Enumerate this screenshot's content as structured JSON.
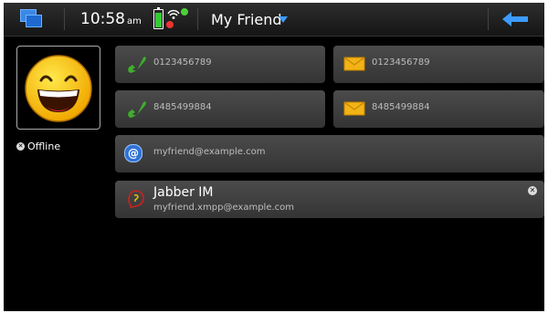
{
  "statusbar": {
    "time": "10:58",
    "ampm": "am",
    "title": "My Friend",
    "icons": [
      "task-switcher-icon",
      "battery-icon",
      "signal-icon",
      "presence-online-icon",
      "menu-arrow-icon",
      "back-arrow-icon"
    ],
    "accent_color": "#3c9bff"
  },
  "contact": {
    "avatar": "smiley-face-avatar",
    "presence": "Offline"
  },
  "details": {
    "phones": [
      {
        "number": "0123456789",
        "icon": "phone-icon"
      },
      {
        "number": "8485499884",
        "icon": "phone-icon"
      }
    ],
    "messages": [
      {
        "number": "0123456789",
        "icon": "sms-envelope-icon"
      },
      {
        "number": "8485499884",
        "icon": "sms-envelope-icon"
      }
    ],
    "email": {
      "address": "myfriend@example.com",
      "icon": "email-at-icon"
    },
    "im": {
      "service": "Jabber IM",
      "address": "myfriend.xmpp@example.com",
      "icon": "jabber-icon",
      "status_icon": "offline-icon"
    }
  }
}
